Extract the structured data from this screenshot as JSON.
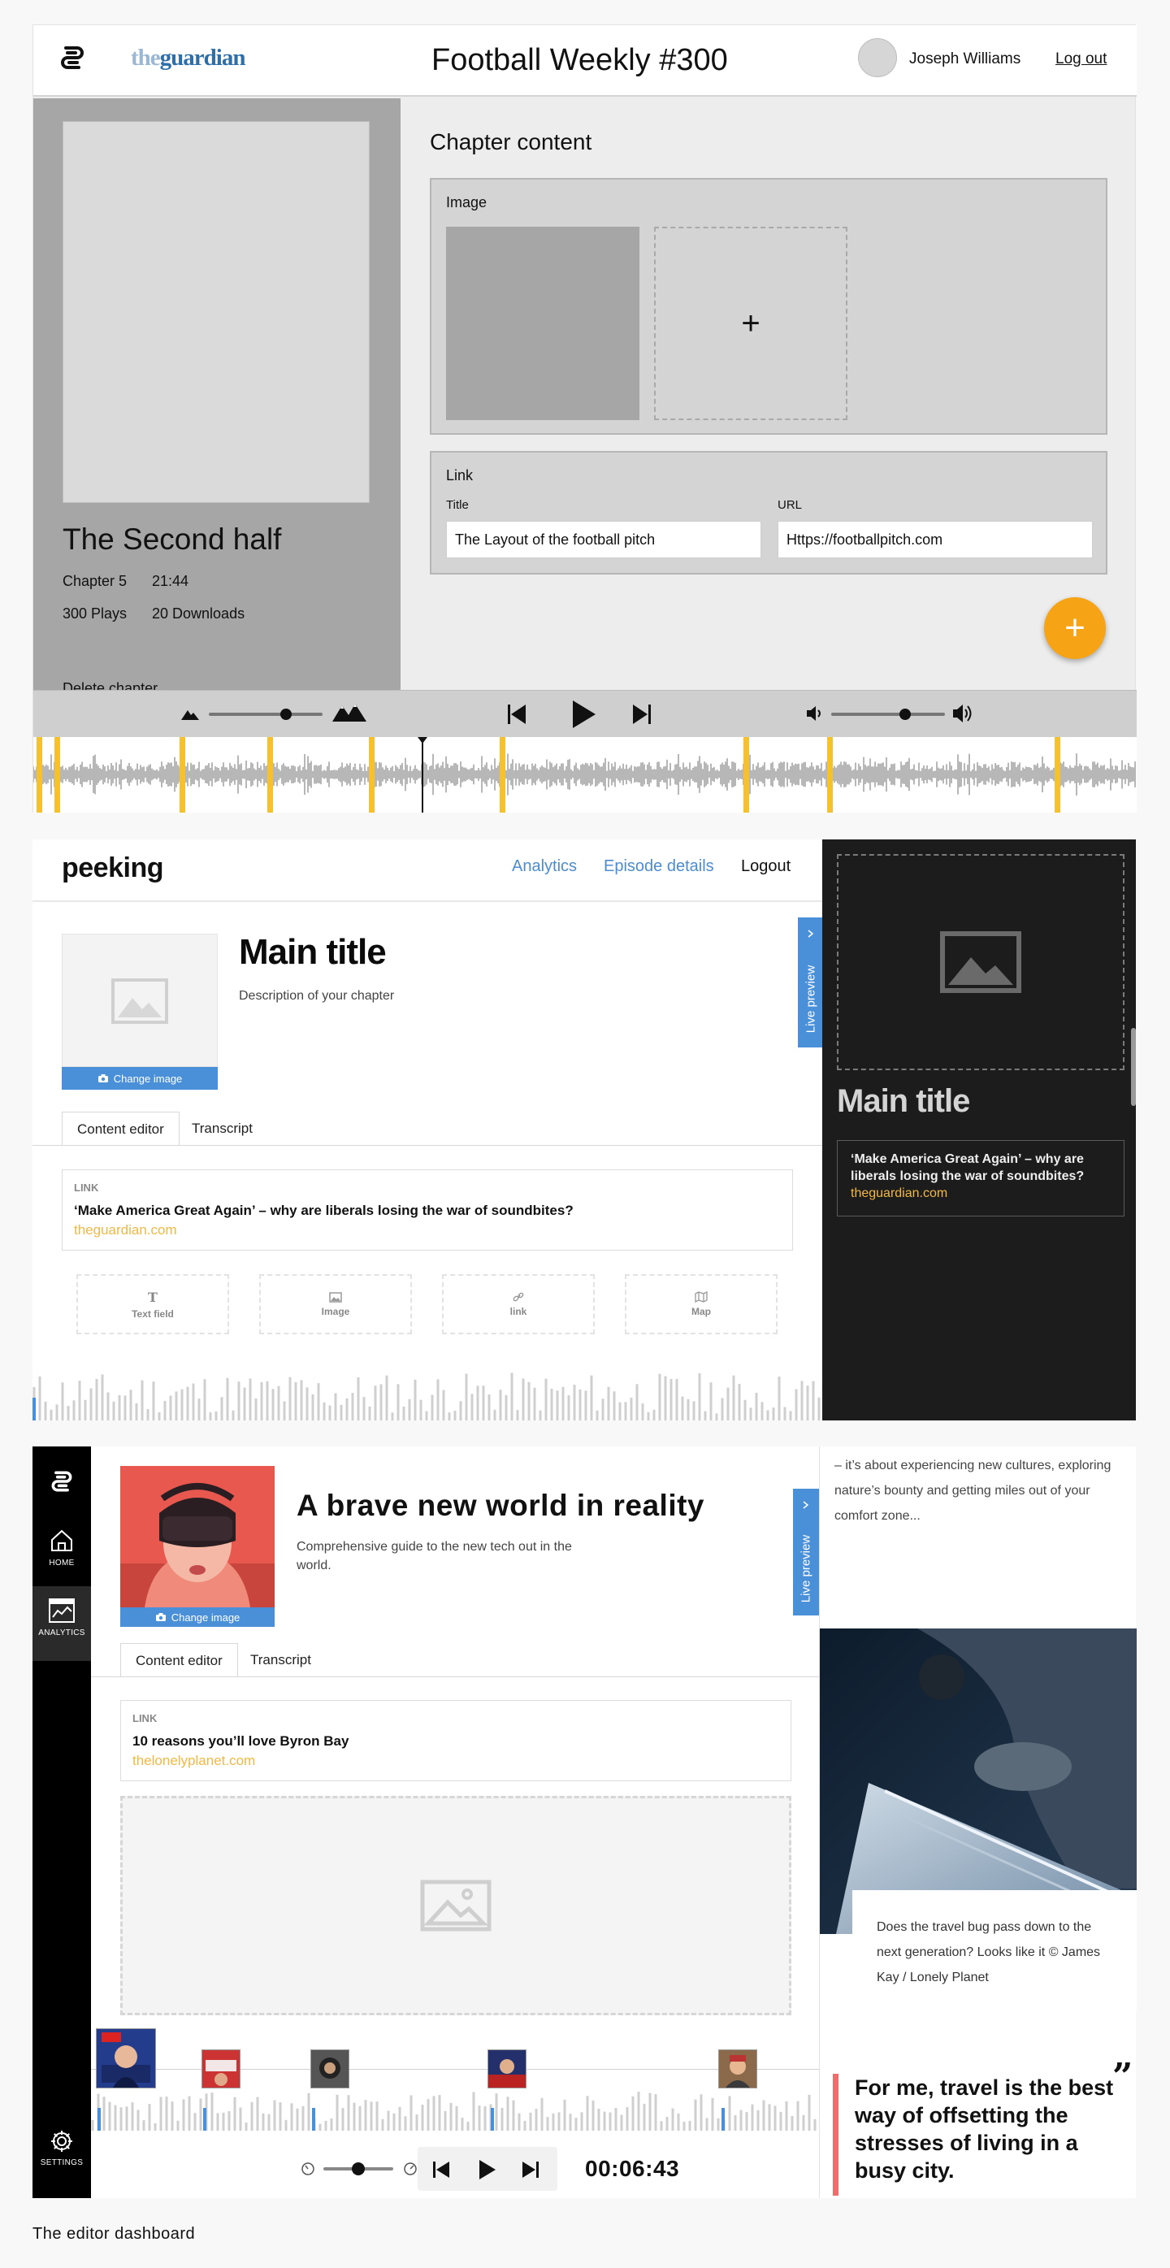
{
  "panel1": {
    "brand": {
      "prefix": "the",
      "name": "guardian"
    },
    "episode_title": "Football Weekly #300",
    "user": {
      "name": "Joseph Williams",
      "logout": "Log out"
    },
    "chapter": {
      "title": "The Second half",
      "number": "Chapter 5",
      "duration": "21:44",
      "plays": "300 Plays",
      "downloads": "20 Downloads",
      "delete": "Delete chapter"
    },
    "content_title": "Chapter content",
    "image_section": {
      "label": "Image",
      "add_symbol": "+"
    },
    "link_section": {
      "label": "Link",
      "title_label": "Title",
      "title_value": "The Layout of the football pitch",
      "url_label": "URL",
      "url_value": "Https://footballpitch.com"
    },
    "fab_symbol": "+",
    "speed_level": 0.68,
    "volume_level": 0.65,
    "accent": "#f6a416",
    "marker_color": "#f5c12e"
  },
  "panel2": {
    "brand": "peeking",
    "nav": [
      "Analytics",
      "Episode details",
      "Logout"
    ],
    "main_title": "Main title",
    "description": "Description of your chapter",
    "change_image": "Change image",
    "live_preview": "Live preview",
    "tabs": [
      "Content editor",
      "Transcript"
    ],
    "link": {
      "label": "LINK",
      "title": "‘Make America Great Again’ – why are liberals losing the war of soundbites?",
      "url": "theguardian.com"
    },
    "tools": [
      "Text field",
      "Image",
      "link",
      "Map"
    ],
    "preview": {
      "title": "Main title",
      "link_title": "‘Make America Great Again’ – why are liberals losing the war of soundbites?",
      "link_url": "theguardian.com"
    },
    "link_color": "#4d8ccf"
  },
  "panel3": {
    "sidebar": [
      {
        "label": "HOME",
        "icon": "home-icon"
      },
      {
        "label": "ANALYTICS",
        "icon": "analytics-icon"
      },
      {
        "label": "SETTINGS",
        "icon": "gear-icon"
      }
    ],
    "title": "A brave new world in reality",
    "description": "Comprehensive guide to the new tech out in the world.",
    "change_image": "Change image",
    "live_preview": "Live preview",
    "tabs": [
      "Content editor",
      "Transcript"
    ],
    "link": {
      "label": "LINK",
      "title": "10 reasons you’ll love Byron Bay",
      "url": "thelonelyplanet.com"
    },
    "time": "00:06:43",
    "speed_level": 0.5,
    "preview": {
      "text": "– it’s about experiencing new cultures, exploring nature’s bounty and getting miles out of your comfort zone...",
      "caption": "Does the travel bug pass down to the next generation? Looks like it © James Kay / Lonely Planet",
      "quote": "For me, travel is the best way of offsetting the stresses of living in a busy city.",
      "quote_mark": "”"
    },
    "quote_color": "#ef6c6c"
  },
  "footer": "The editor dashboard"
}
